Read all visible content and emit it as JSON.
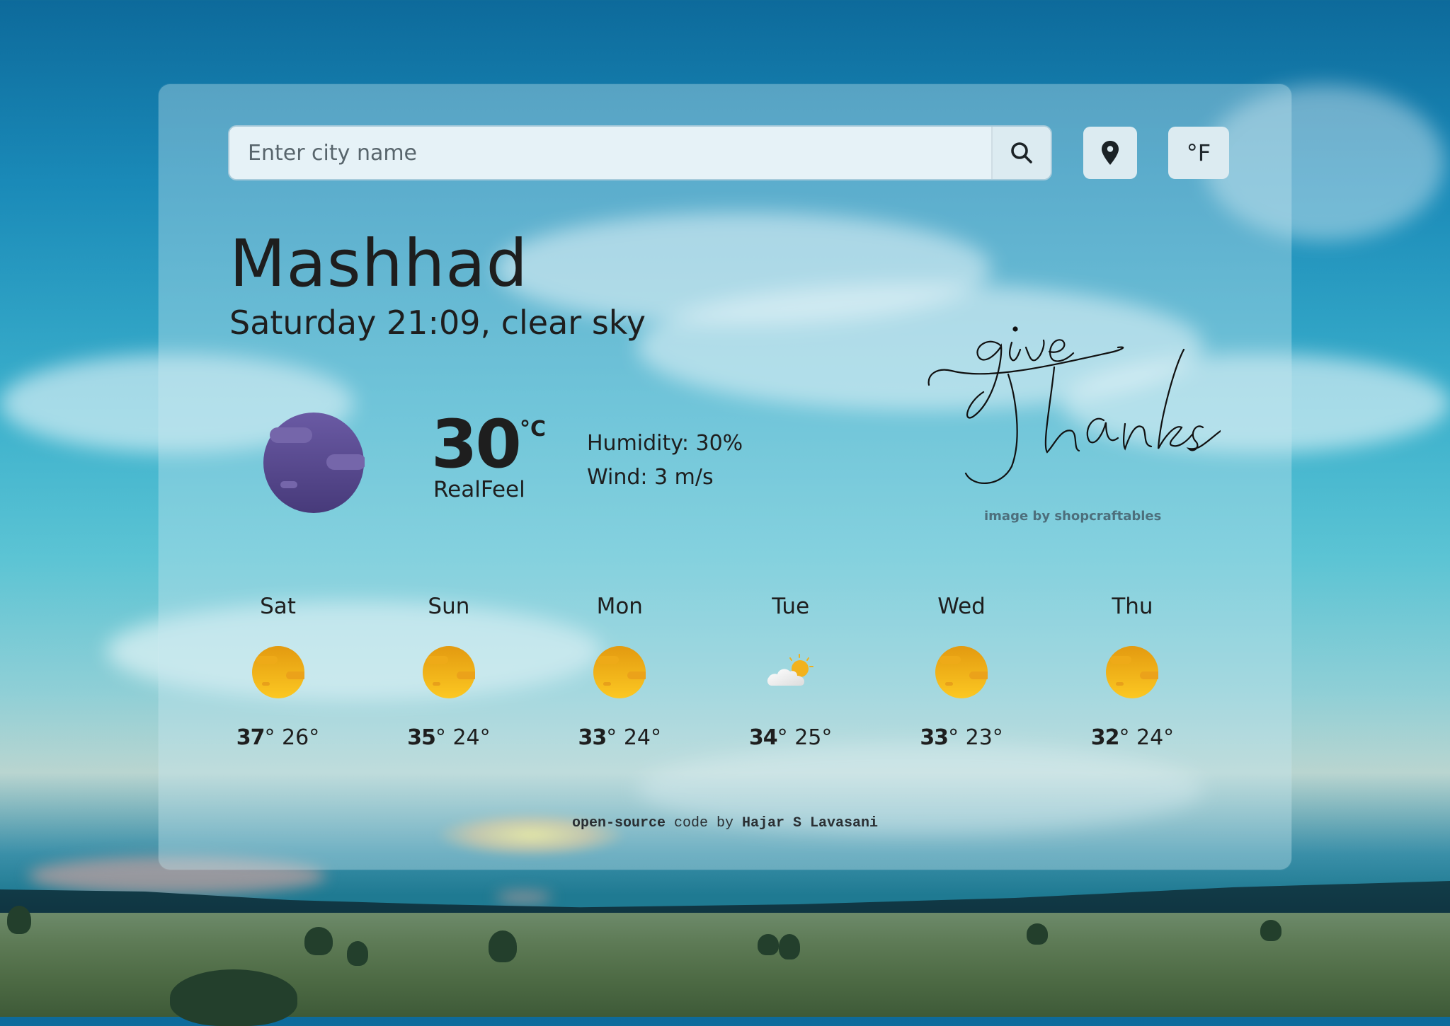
{
  "search": {
    "placeholder": "Enter city name",
    "value": "",
    "search_icon": "search-icon",
    "location_icon": "map-pin-icon",
    "unit_toggle_label": "°F"
  },
  "current": {
    "city": "Mashhad",
    "day_time_condition": "Saturday 21:09, clear sky",
    "icon": "clear-night-moon-icon",
    "temperature": "30",
    "unit": "°C",
    "realfeel_label": "RealFeel",
    "humidity": "Humidity: 30%",
    "wind": "Wind: 3 m/s"
  },
  "decoration": {
    "script_text_line1": "give",
    "script_text_line2": "Thanks",
    "credit": "image by shopcraftables"
  },
  "forecast": [
    {
      "day": "Sat",
      "icon": "sun-icon",
      "high": "37",
      "low": "26°"
    },
    {
      "day": "Sun",
      "icon": "sun-icon",
      "high": "35",
      "low": "24°"
    },
    {
      "day": "Mon",
      "icon": "sun-icon",
      "high": "33",
      "low": "24°"
    },
    {
      "day": "Tue",
      "icon": "partly-cloudy-icon",
      "high": "34",
      "low": "25°"
    },
    {
      "day": "Wed",
      "icon": "sun-icon",
      "high": "33",
      "low": "23°"
    },
    {
      "day": "Thu",
      "icon": "sun-icon",
      "high": "32",
      "low": "24°"
    }
  ],
  "footer": {
    "part1": "open-source",
    "part2": " code by ",
    "part3": "Hajar S Lavasani"
  },
  "colors": {
    "moon": "#5a4a92",
    "sun": "#f2b21c",
    "text": "#1e1e1e"
  }
}
